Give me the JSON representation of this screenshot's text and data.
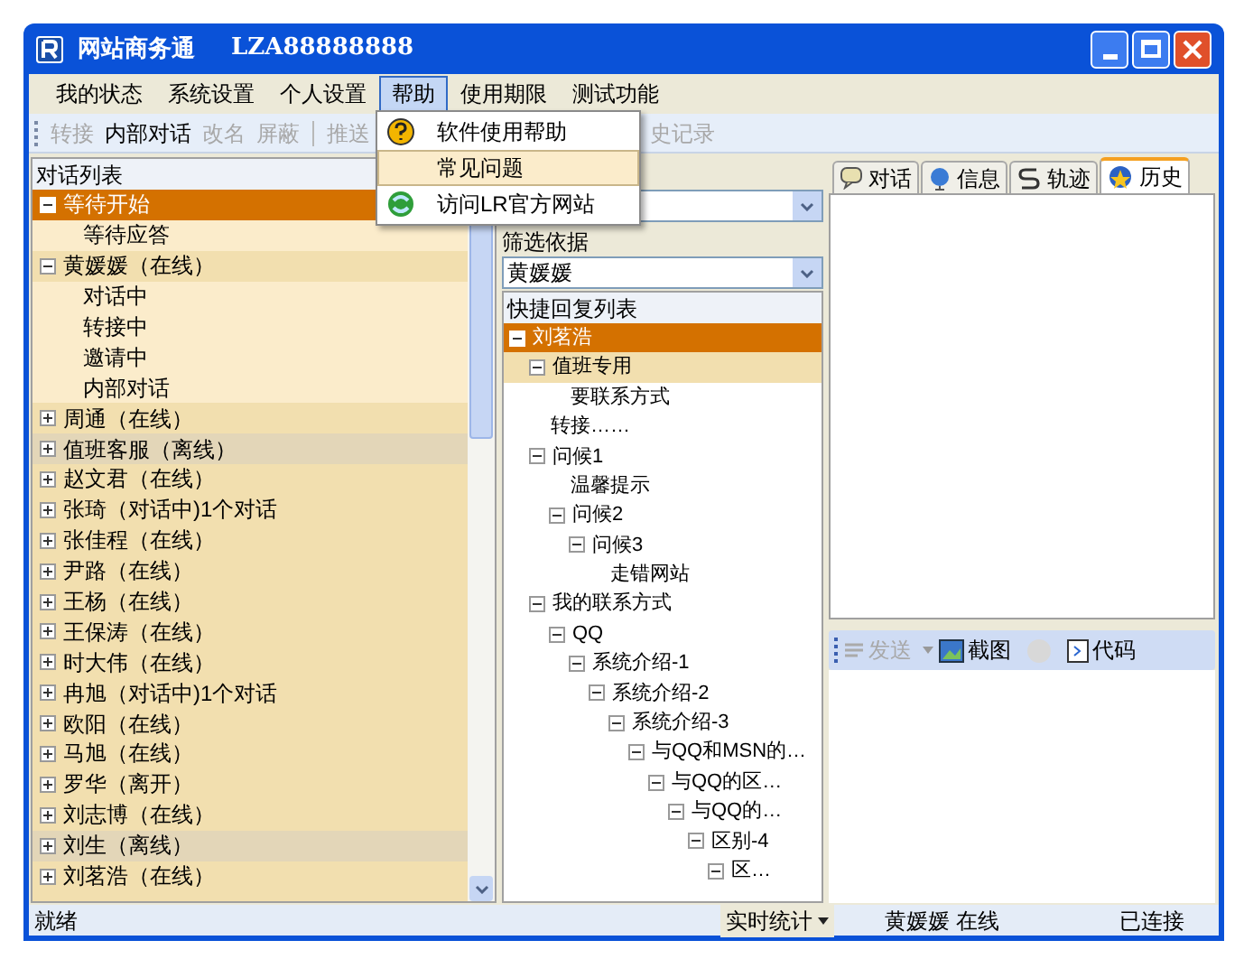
{
  "window": {
    "title": "网站商务通",
    "account": "LZA88888888"
  },
  "menu_bar": [
    {
      "label": "我的状态",
      "open": false
    },
    {
      "label": "系统设置",
      "open": false
    },
    {
      "label": "个人设置",
      "open": false
    },
    {
      "label": "帮助",
      "open": true
    },
    {
      "label": "使用期限",
      "open": false
    },
    {
      "label": "测试功能",
      "open": false
    }
  ],
  "help_menu": [
    {
      "label": "软件使用帮助",
      "kind": "help",
      "selected": false
    },
    {
      "label": "常见问题",
      "kind": "plain",
      "selected": true
    },
    {
      "label": "访问LR官方网站",
      "kind": "web",
      "selected": false
    }
  ],
  "toolbar": {
    "left": [
      {
        "label": "转接",
        "disabled": true
      },
      {
        "label": "内部对话",
        "disabled": false
      },
      {
        "label": "改名",
        "disabled": true
      },
      {
        "label": "屏蔽",
        "disabled": true
      },
      {
        "label": "推送",
        "disabled": true
      }
    ],
    "right": [
      {
        "label": "史记录",
        "disabled": true
      }
    ]
  },
  "conversation_list": {
    "title": "对话列表",
    "items": [
      {
        "label": "等待开始",
        "selected": true,
        "offline": false,
        "expanded": true,
        "children": [
          {
            "label": "等待应答"
          }
        ]
      },
      {
        "label": "黄媛媛（在线）",
        "selected": false,
        "offline": false,
        "expanded": true,
        "children": [
          {
            "label": "对话中"
          },
          {
            "label": "转接中"
          },
          {
            "label": "邀请中"
          },
          {
            "label": "内部对话"
          }
        ]
      },
      {
        "label": "周通（在线）",
        "selected": false,
        "offline": false,
        "expanded": false
      },
      {
        "label": "值班客服（离线）",
        "selected": false,
        "offline": true,
        "expanded": false
      },
      {
        "label": "赵文君（在线）",
        "selected": false,
        "offline": false,
        "expanded": false
      },
      {
        "label": "张琦（对话中)1个对话",
        "selected": false,
        "offline": false,
        "expanded": false
      },
      {
        "label": "张佳程（在线）",
        "selected": false,
        "offline": false,
        "expanded": false
      },
      {
        "label": "尹路（在线）",
        "selected": false,
        "offline": false,
        "expanded": false
      },
      {
        "label": "王杨（在线）",
        "selected": false,
        "offline": false,
        "expanded": false
      },
      {
        "label": "王保涛（在线）",
        "selected": false,
        "offline": false,
        "expanded": false
      },
      {
        "label": "时大伟（在线）",
        "selected": false,
        "offline": false,
        "expanded": false
      },
      {
        "label": "冉旭（对话中)1个对话",
        "selected": false,
        "offline": false,
        "expanded": false
      },
      {
        "label": "欧阳（在线）",
        "selected": false,
        "offline": false,
        "expanded": false
      },
      {
        "label": "马旭（在线）",
        "selected": false,
        "offline": false,
        "expanded": false
      },
      {
        "label": "罗华（离开）",
        "selected": false,
        "offline": false,
        "expanded": false
      },
      {
        "label": "刘志博（在线）",
        "selected": false,
        "offline": false,
        "expanded": false
      },
      {
        "label": "刘生（离线）",
        "selected": false,
        "offline": true,
        "expanded": false
      },
      {
        "label": "刘茗浩（在线）",
        "selected": false,
        "offline": false,
        "expanded": false
      }
    ]
  },
  "filter": {
    "label": "筛选依据",
    "value": "黄媛媛"
  },
  "quick_reply": {
    "title": "快捷回复列表",
    "items": [
      {
        "label": "刘茗浩",
        "selected": true,
        "highlighted": false,
        "expanded": true,
        "children": [
          {
            "label": "值班专用",
            "selected": false,
            "highlighted": true,
            "expanded": true,
            "children": [
              {
                "label": "要联系方式"
              }
            ]
          },
          {
            "label": "转接……"
          },
          {
            "label": "问候1",
            "selected": false,
            "highlighted": false,
            "expanded": true,
            "children": [
              {
                "label": "温馨提示"
              },
              {
                "label": "问候2",
                "selected": false,
                "highlighted": false,
                "expanded": true,
                "children": [
                  {
                    "label": "问候3",
                    "selected": false,
                    "highlighted": false,
                    "expanded": true,
                    "children": [
                      {
                        "label": "走错网站"
                      }
                    ]
                  }
                ]
              }
            ]
          },
          {
            "label": "我的联系方式",
            "selected": false,
            "highlighted": false,
            "expanded": true,
            "children": [
              {
                "label": "QQ",
                "selected": false,
                "highlighted": false,
                "expanded": true,
                "children": [
                  {
                    "label": "系统介绍-1",
                    "selected": false,
                    "highlighted": false,
                    "expanded": true,
                    "children": [
                      {
                        "label": "系统介绍-2",
                        "selected": false,
                        "highlighted": false,
                        "expanded": true,
                        "children": [
                          {
                            "label": "系统介绍-3",
                            "selected": false,
                            "highlighted": false,
                            "expanded": true,
                            "children": [
                              {
                                "label": "与QQ和MSN的…",
                                "selected": false,
                                "highlighted": false,
                                "expanded": true,
                                "children": [
                                  {
                                    "label": "与QQ的区…",
                                    "selected": false,
                                    "highlighted": false,
                                    "expanded": true,
                                    "children": [
                                      {
                                        "label": "与QQ的…",
                                        "selected": false,
                                        "highlighted": false,
                                        "expanded": true,
                                        "children": [
                                          {
                                            "label": "区别-4",
                                            "selected": false,
                                            "highlighted": false,
                                            "expanded": true,
                                            "children": [
                                              {
                                                "label": "区…",
                                                "selected": false,
                                                "highlighted": false,
                                                "expanded": true
                                              }
                                            ]
                                          }
                                        ]
                                      }
                                    ]
                                  }
                                ]
                              }
                            ]
                          }
                        ]
                      }
                    ]
                  }
                ]
              }
            ]
          }
        ]
      }
    ]
  },
  "side_tabs": [
    {
      "label": "对话",
      "kind": "chat",
      "selected": false
    },
    {
      "label": "信息",
      "kind": "info",
      "selected": false
    },
    {
      "label": "轨迹",
      "kind": "track",
      "selected": false
    },
    {
      "label": "历史",
      "kind": "history",
      "selected": true
    }
  ],
  "send_toolbar": [
    {
      "label": "发送",
      "kind": "send",
      "disabled": true
    },
    {
      "kind": "emoji-dropdown",
      "label": "截图",
      "disabled": false
    },
    {
      "kind": "code",
      "label": "代码",
      "disabled": false
    }
  ],
  "status_bar": {
    "status": "就绪",
    "stats": "实时统计",
    "user": "黄媛媛 在线",
    "connection": "已连接"
  }
}
